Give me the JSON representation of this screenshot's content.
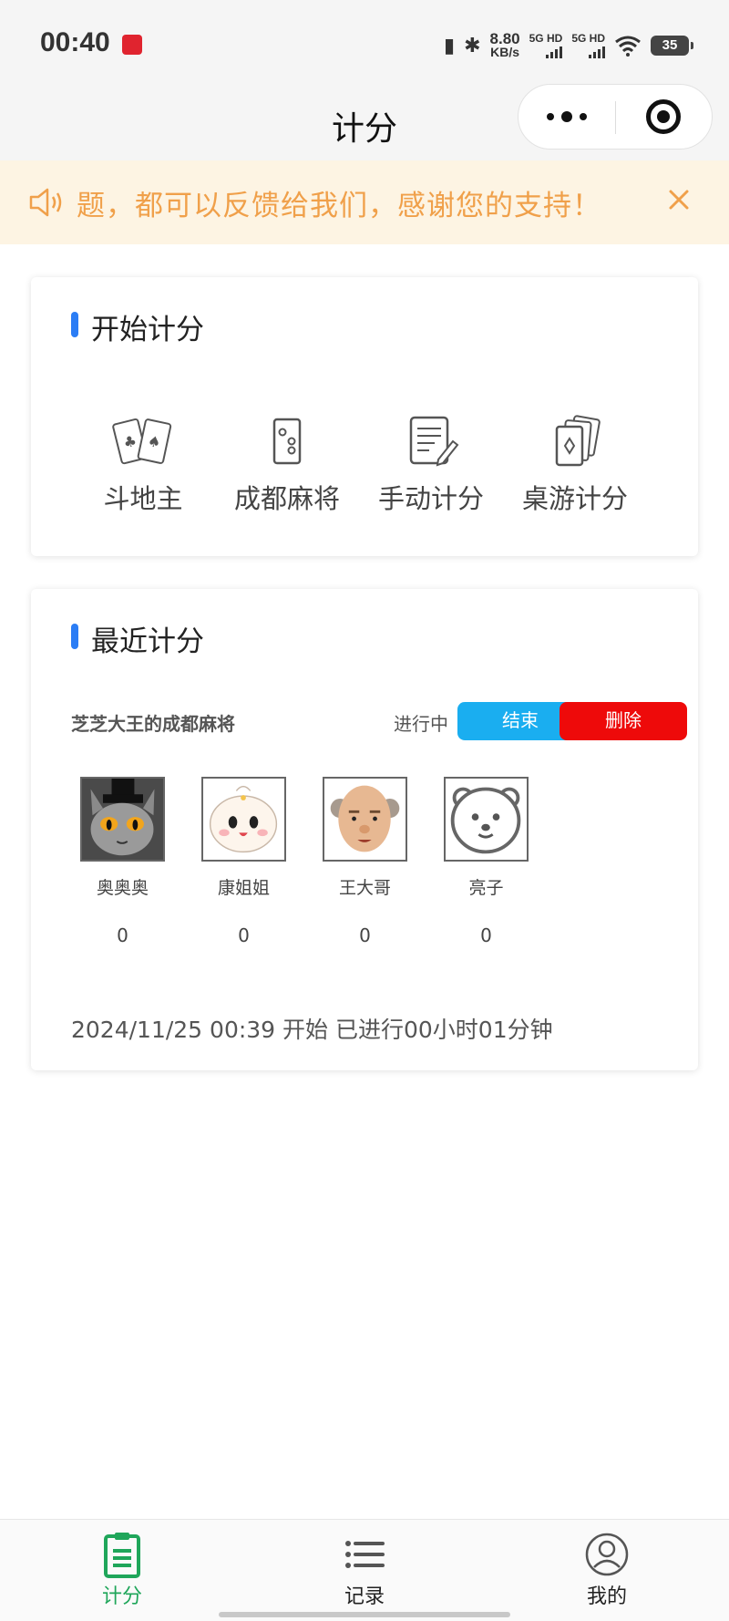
{
  "status_bar": {
    "time": "00:40",
    "net_speed_value": "8.80",
    "net_speed_unit": "KB/s",
    "sim1": "5G HD",
    "sim2": "5G HD",
    "battery": "35"
  },
  "nav": {
    "title": "计分"
  },
  "notice": {
    "text": "题，都可以反馈给我们，感谢您的支持！",
    "color": "#f0a04a"
  },
  "start_section": {
    "title": "开始计分",
    "games": [
      {
        "label": "斗地主",
        "icon": "playing-cards-icon"
      },
      {
        "label": "成都麻将",
        "icon": "mahjong-tile-icon"
      },
      {
        "label": "手动计分",
        "icon": "document-edit-icon"
      },
      {
        "label": "桌游计分",
        "icon": "card-deck-icon"
      }
    ]
  },
  "recent_section": {
    "title": "最近计分",
    "game_name": "芝芝大王的成都麻将",
    "status": "进行中",
    "end_button": "结束",
    "delete_button": "删除",
    "players": [
      {
        "name": "奥奥奥",
        "score": "0"
      },
      {
        "name": "康姐姐",
        "score": "0"
      },
      {
        "name": "王大哥",
        "score": "0"
      },
      {
        "name": "亮子",
        "score": "0"
      }
    ],
    "time_info": "2024/11/25 00:39 开始 已进行00小时01分钟"
  },
  "tabbar": {
    "items": [
      {
        "label": "计分",
        "icon": "clipboard-icon",
        "active": true
      },
      {
        "label": "记录",
        "icon": "list-icon",
        "active": false
      },
      {
        "label": "我的",
        "icon": "user-icon",
        "active": false
      }
    ],
    "active_color": "#1fa65a"
  },
  "colors": {
    "accent_blue": "#2b7df5",
    "end_button": "#1aaef0",
    "delete_button": "#ee0a0a"
  }
}
